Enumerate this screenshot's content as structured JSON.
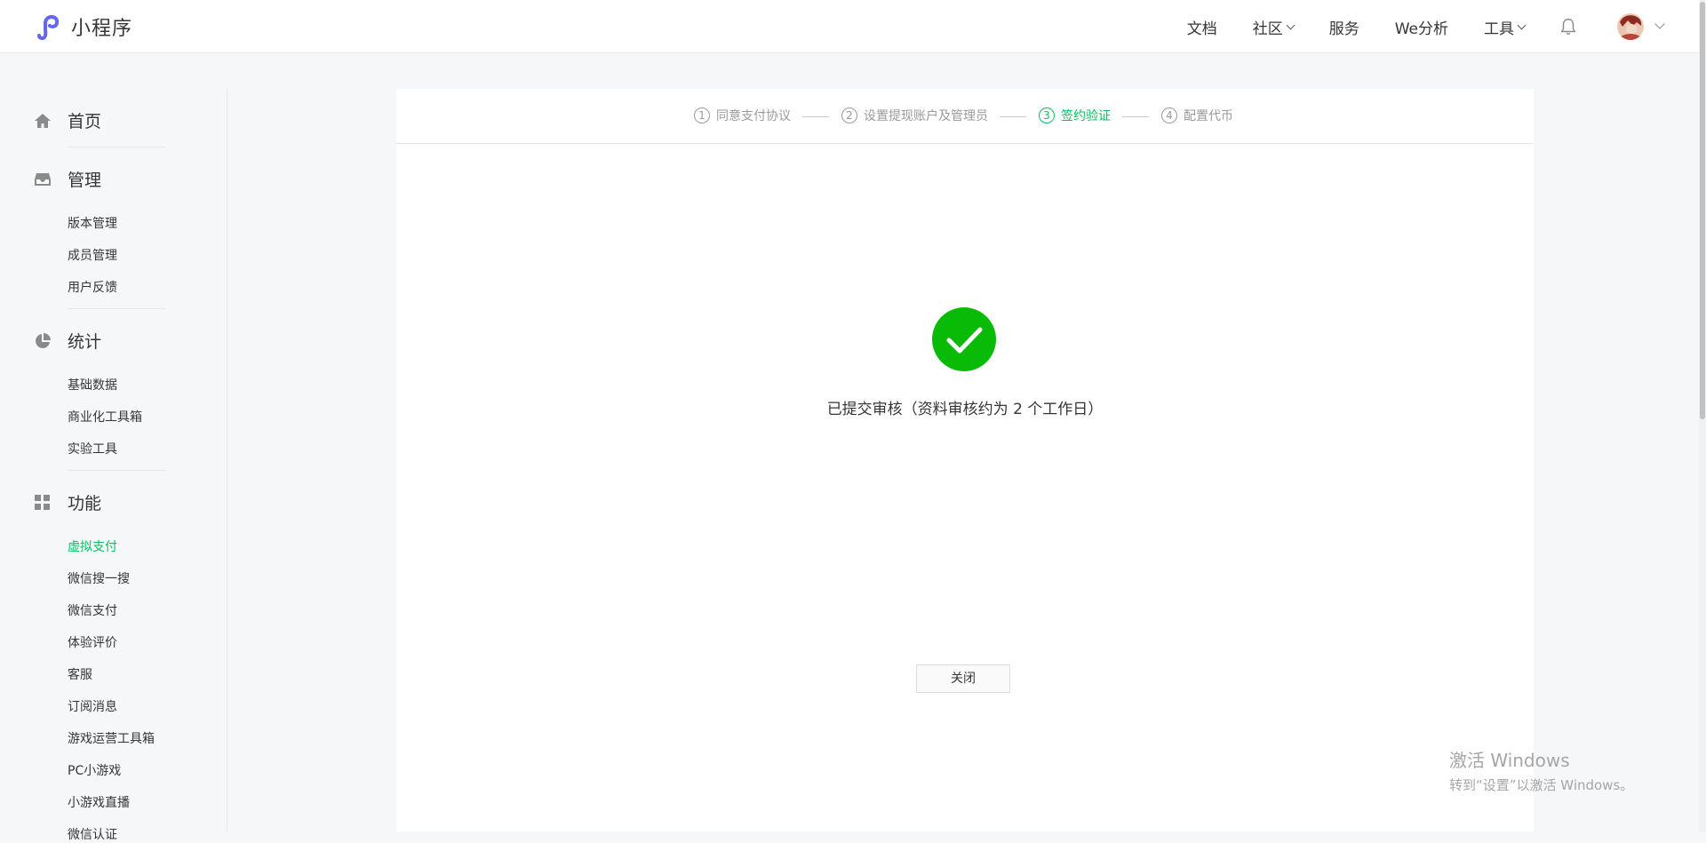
{
  "app": {
    "title": "小程序",
    "accent": "#07c160",
    "logo_color": "#6467f0"
  },
  "topnav": [
    {
      "label": "文档",
      "has_dropdown": false
    },
    {
      "label": "社区",
      "has_dropdown": true
    },
    {
      "label": "服务",
      "has_dropdown": false
    },
    {
      "label": "We分析",
      "has_dropdown": false
    },
    {
      "label": "工具",
      "has_dropdown": true
    }
  ],
  "sidebar": {
    "sections": [
      {
        "label": "首页",
        "icon": "home-icon",
        "items": []
      },
      {
        "label": "管理",
        "icon": "inbox-icon",
        "items": [
          "版本管理",
          "成员管理",
          "用户反馈"
        ]
      },
      {
        "label": "统计",
        "icon": "pie-chart-icon",
        "items": [
          "基础数据",
          "商业化工具箱",
          "实验工具"
        ]
      },
      {
        "label": "功能",
        "icon": "grid-icon",
        "items": [
          "虚拟支付",
          "微信搜一搜",
          "微信支付",
          "体验评价",
          "客服",
          "订阅消息",
          "游戏运营工具箱",
          "PC小游戏",
          "小游戏直播",
          "微信认证"
        ]
      }
    ],
    "active_item": "虚拟支付"
  },
  "steps": [
    {
      "num": "1",
      "label": "同意支付协议",
      "state": "done"
    },
    {
      "num": "2",
      "label": "设置提现账户及管理员",
      "state": "done"
    },
    {
      "num": "3",
      "label": "签约验证",
      "state": "active"
    },
    {
      "num": "4",
      "label": "配置代币",
      "state": "pending"
    }
  ],
  "result": {
    "icon": "check-circle-icon",
    "message": "已提交审核（资料审核约为 2 个工作日）",
    "close_label": "关闭"
  },
  "watermark": {
    "line1": "激活 Windows",
    "line2": "转到“设置”以激活 Windows。"
  }
}
